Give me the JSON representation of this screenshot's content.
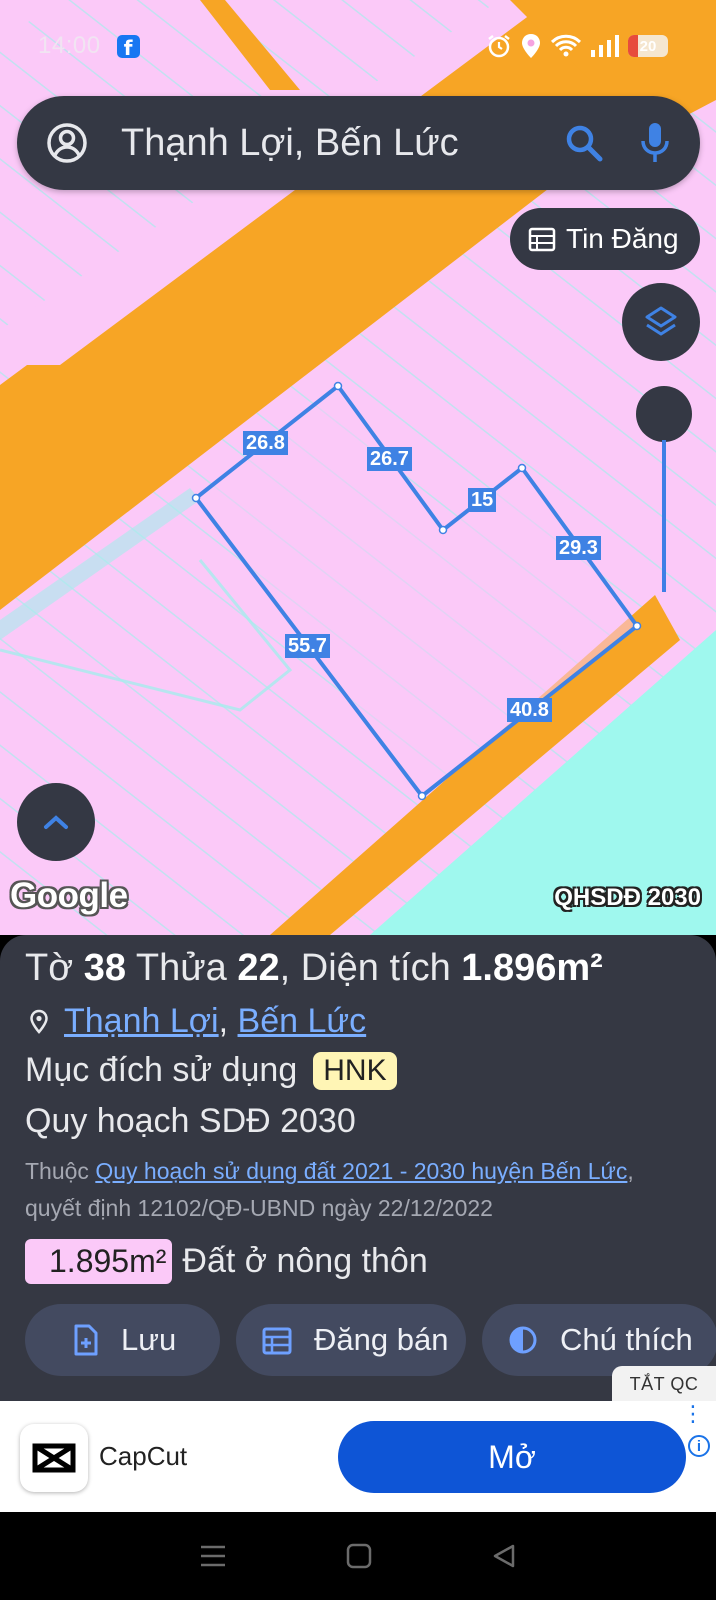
{
  "status_bar": {
    "time": "14:00",
    "battery": "20"
  },
  "search": {
    "query": "Thạnh Lợi, Bến Lức"
  },
  "buttons": {
    "tin_dang": "Tin Đăng"
  },
  "map": {
    "edge_labels": [
      "26.8",
      "26.7",
      "15",
      "29.3",
      "55.7",
      "40.8"
    ],
    "google_logo": "Google",
    "layer_name": "QHSDĐ 2030",
    "colors": {
      "residential": "#fbc9f8",
      "road": "#f7a525",
      "water": "#9ff8ee",
      "parcel_outline": "#3f82e4"
    }
  },
  "parcel": {
    "to_label": "Tờ",
    "to_value": "38",
    "thua_label": "Thửa",
    "thua_value": "22",
    "dientich_label": "Diện tích",
    "dientich_value": "1.896m²",
    "commune": "Thạnh Lợi",
    "district": "Bến Lức",
    "purpose_label": "Mục đích sử dụng",
    "purpose_code": "HNK",
    "plan_title": "Quy hoạch SDĐ 2030",
    "belong_prefix": "Thuộc",
    "belong_link": "Quy hoạch sử dụng đất 2021 - 2030 huyện Bến Lức",
    "decision": "quyết định 12102/QĐ-UBND ngày 22/12/2022",
    "zone_area": "1.895m²",
    "zone_type": "Đất ở nông thôn"
  },
  "actions": {
    "save": "Lưu",
    "sell": "Đăng bán",
    "legend": "Chú thích"
  },
  "ad": {
    "tag": "TẮT QC",
    "app_name": "CapCut",
    "open_label": "Mở"
  }
}
